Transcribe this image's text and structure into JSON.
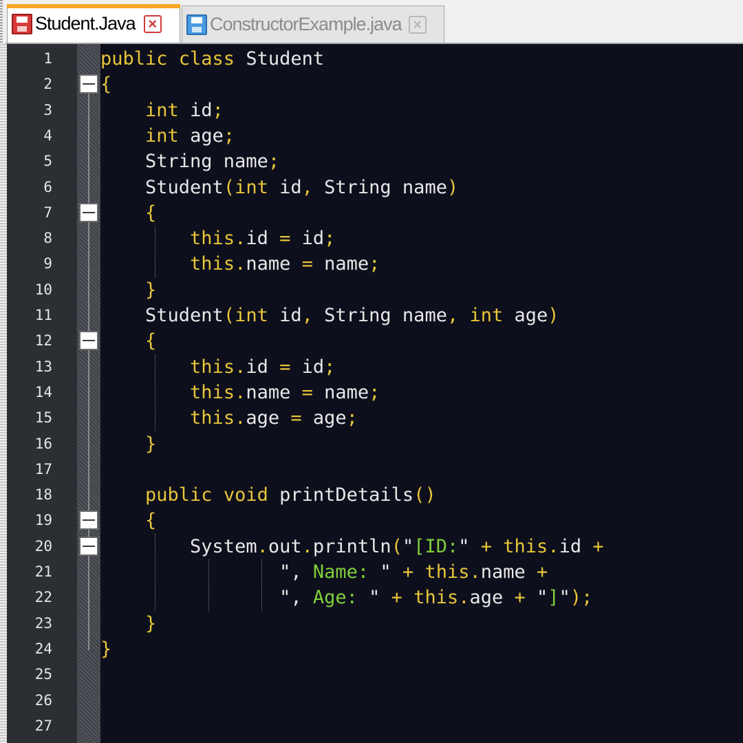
{
  "tabs": [
    {
      "label": "Student.Java",
      "active": true,
      "icon": "save-file-icon-red"
    },
    {
      "label": "ConstructorExample.java",
      "active": false,
      "icon": "save-file-icon-blue"
    }
  ],
  "colors": {
    "editor_background": "#0d0f1c",
    "keyword": "#e8c53a",
    "identifier": "#e8e8e8",
    "string": "#7fcf3a",
    "line_number_background": "#2b2f33",
    "active_tab_accent": "#f5a623"
  },
  "editor": {
    "line_numbers": [
      "1",
      "2",
      "3",
      "4",
      "5",
      "6",
      "7",
      "8",
      "9",
      "10",
      "11",
      "12",
      "13",
      "14",
      "15",
      "16",
      "17",
      "18",
      "19",
      "20",
      "21",
      "22",
      "23",
      "24",
      "25",
      "26",
      "27"
    ],
    "fold_markers_on_lines": [
      2,
      7,
      12,
      19,
      20
    ],
    "lines": [
      [
        [
          "kw",
          "public class "
        ],
        [
          "pl",
          "Student"
        ]
      ],
      [
        [
          "op",
          "{"
        ]
      ],
      [
        [
          "pl",
          "    "
        ],
        [
          "kw",
          "int "
        ],
        [
          "pl",
          "id"
        ],
        [
          "op",
          ";"
        ]
      ],
      [
        [
          "pl",
          "    "
        ],
        [
          "kw",
          "int "
        ],
        [
          "pl",
          "age"
        ],
        [
          "op",
          ";"
        ]
      ],
      [
        [
          "pl",
          "    String name"
        ],
        [
          "op",
          ";"
        ]
      ],
      [
        [
          "pl",
          "    Student"
        ],
        [
          "op",
          "("
        ],
        [
          "kw",
          "int "
        ],
        [
          "pl",
          "id"
        ],
        [
          "op",
          ", "
        ],
        [
          "pl",
          "String name"
        ],
        [
          "op",
          ")"
        ]
      ],
      [
        [
          "pl",
          "    "
        ],
        [
          "op",
          "{"
        ]
      ],
      [
        [
          "pl",
          "        "
        ],
        [
          "kw",
          "this"
        ],
        [
          "op",
          "."
        ],
        [
          "pl",
          "id "
        ],
        [
          "op",
          "= "
        ],
        [
          "pl",
          "id"
        ],
        [
          "op",
          ";"
        ]
      ],
      [
        [
          "pl",
          "        "
        ],
        [
          "kw",
          "this"
        ],
        [
          "op",
          "."
        ],
        [
          "pl",
          "name "
        ],
        [
          "op",
          "= "
        ],
        [
          "pl",
          "name"
        ],
        [
          "op",
          ";"
        ]
      ],
      [
        [
          "pl",
          "    "
        ],
        [
          "op",
          "}"
        ]
      ],
      [
        [
          "pl",
          "    Student"
        ],
        [
          "op",
          "("
        ],
        [
          "kw",
          "int "
        ],
        [
          "pl",
          "id"
        ],
        [
          "op",
          ", "
        ],
        [
          "pl",
          "String name"
        ],
        [
          "op",
          ", "
        ],
        [
          "kw",
          "int "
        ],
        [
          "pl",
          "age"
        ],
        [
          "op",
          ")"
        ]
      ],
      [
        [
          "pl",
          "    "
        ],
        [
          "op",
          "{"
        ]
      ],
      [
        [
          "pl",
          "        "
        ],
        [
          "kw",
          "this"
        ],
        [
          "op",
          "."
        ],
        [
          "pl",
          "id "
        ],
        [
          "op",
          "= "
        ],
        [
          "pl",
          "id"
        ],
        [
          "op",
          ";"
        ]
      ],
      [
        [
          "pl",
          "        "
        ],
        [
          "kw",
          "this"
        ],
        [
          "op",
          "."
        ],
        [
          "pl",
          "name "
        ],
        [
          "op",
          "= "
        ],
        [
          "pl",
          "name"
        ],
        [
          "op",
          ";"
        ]
      ],
      [
        [
          "pl",
          "        "
        ],
        [
          "kw",
          "this"
        ],
        [
          "op",
          "."
        ],
        [
          "pl",
          "age "
        ],
        [
          "op",
          "= "
        ],
        [
          "pl",
          "age"
        ],
        [
          "op",
          ";"
        ]
      ],
      [
        [
          "pl",
          "    "
        ],
        [
          "op",
          "}"
        ]
      ],
      [],
      [
        [
          "pl",
          "    "
        ],
        [
          "kw",
          "public void "
        ],
        [
          "pl",
          "printDetails"
        ],
        [
          "op",
          "()"
        ]
      ],
      [
        [
          "pl",
          "    "
        ],
        [
          "op",
          "{"
        ]
      ],
      [
        [
          "pl",
          "        System"
        ],
        [
          "op",
          "."
        ],
        [
          "pl",
          "out"
        ],
        [
          "op",
          "."
        ],
        [
          "pl",
          "println"
        ],
        [
          "op",
          "("
        ],
        [
          "strq",
          "\""
        ],
        [
          "str",
          "[ID:"
        ],
        [
          "strq",
          "\" "
        ],
        [
          "op",
          "+ "
        ],
        [
          "kw",
          "this"
        ],
        [
          "op",
          "."
        ],
        [
          "pl",
          "id "
        ],
        [
          "op",
          "+"
        ]
      ],
      [
        [
          "pl",
          "                "
        ],
        [
          "strq",
          "\", "
        ],
        [
          "str",
          "Name: "
        ],
        [
          "strq",
          "\" "
        ],
        [
          "op",
          "+ "
        ],
        [
          "kw",
          "this"
        ],
        [
          "op",
          "."
        ],
        [
          "pl",
          "name "
        ],
        [
          "op",
          "+"
        ]
      ],
      [
        [
          "pl",
          "                "
        ],
        [
          "strq",
          "\", "
        ],
        [
          "str",
          "Age: "
        ],
        [
          "strq",
          "\" "
        ],
        [
          "op",
          "+ "
        ],
        [
          "kw",
          "this"
        ],
        [
          "op",
          "."
        ],
        [
          "pl",
          "age "
        ],
        [
          "op",
          "+ "
        ],
        [
          "strq",
          "\""
        ],
        [
          "str",
          "]"
        ],
        [
          "strq",
          "\""
        ],
        [
          "op",
          ");"
        ]
      ],
      [
        [
          "pl",
          "    "
        ],
        [
          "op",
          "}"
        ]
      ],
      [
        [
          "op",
          "}"
        ]
      ],
      [],
      [],
      []
    ]
  }
}
